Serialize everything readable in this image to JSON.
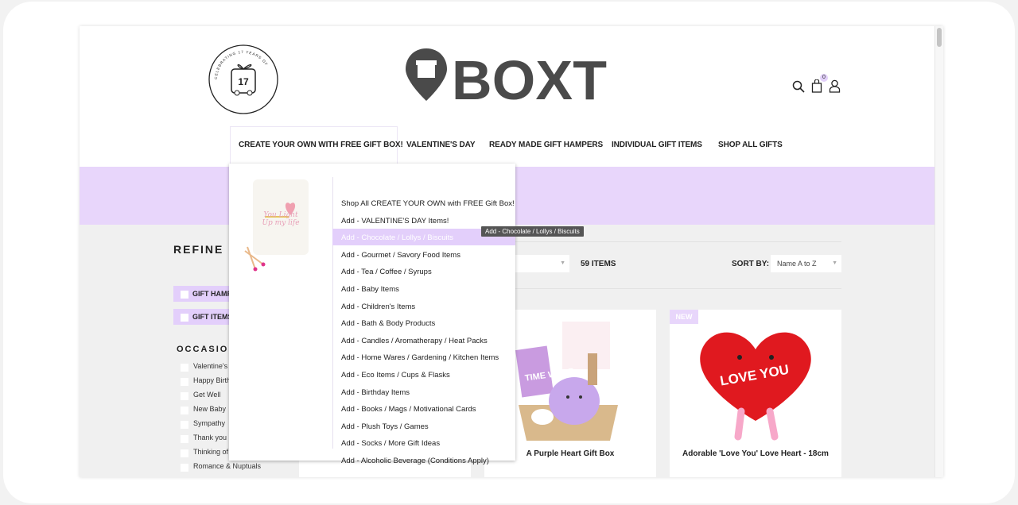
{
  "header": {
    "logo_text": "BOXT",
    "badge_seal": "CELEBRATING 17 YEARS OF QUALITY SERVICE & GIFT GIVING",
    "seal_number": "17",
    "cart_count": "0"
  },
  "nav": {
    "items": [
      "CREATE YOUR OWN WITH FREE GIFT BOX!",
      "VALENTINE'S DAY",
      "READY MADE GIFT HAMPERS",
      "INDIVIDUAL GIFT ITEMS",
      "SHOP ALL GIFTS"
    ],
    "active": 0
  },
  "menu": {
    "items": [
      "Shop All CREATE YOUR OWN with FREE Gift Box!",
      "Add - VALENTINE'S DAY Items!",
      "Add - Chocolate / Lollys / Biscuits",
      "Add - Gourmet / Savory Food Items",
      "Add - Tea / Coffee / Syrups",
      "Add - Baby Items",
      "Add - Children's Items",
      "Add - Bath & Body Products",
      "Add - Candles / Aromatherapy / Heat Packs",
      "Add - Home Wares / Gardening / Kitchen Items",
      "Add - Eco Items / Cups & Flasks",
      "Add - Birthday Items",
      "Add - Books / Mags / Motivational Cards",
      "Add - Plush Toys / Games",
      "Add - Socks / More Gift Ideas",
      "Add - Alcoholic Beverage (Conditions Apply)"
    ],
    "highlighted": 2,
    "tooltip": "Add - Chocolate / Lollys / Biscuits",
    "image_text": "You Light Up my life"
  },
  "sidebar": {
    "title": "REFINE BY",
    "chips": [
      "GIFT HAMPERS",
      "GIFT ITEMS"
    ],
    "occasion_title": "OCCASION",
    "occasions": [
      "Valentine's Day",
      "Happy Birthday",
      "Get Well",
      "New Baby",
      "Sympathy",
      "Thank you",
      "Thinking of You",
      "Romance & Nuptuals"
    ]
  },
  "toolbar": {
    "count": "59 ITEMS",
    "sort_label": "SORT BY:",
    "sort_value": "Name A to Z"
  },
  "products": [
    {
      "title": ""
    },
    {
      "title": "A Purple Heart Gift Box",
      "img_text": "TIME WARP"
    },
    {
      "title": "Adorable 'Love You' Love Heart - 18cm",
      "badge": "NEW",
      "img_text": "LOVE YOU"
    }
  ],
  "colors": {
    "accent": "#e8d6fb",
    "highlight": "#e3cffb",
    "logo": "#4a4a4a"
  }
}
